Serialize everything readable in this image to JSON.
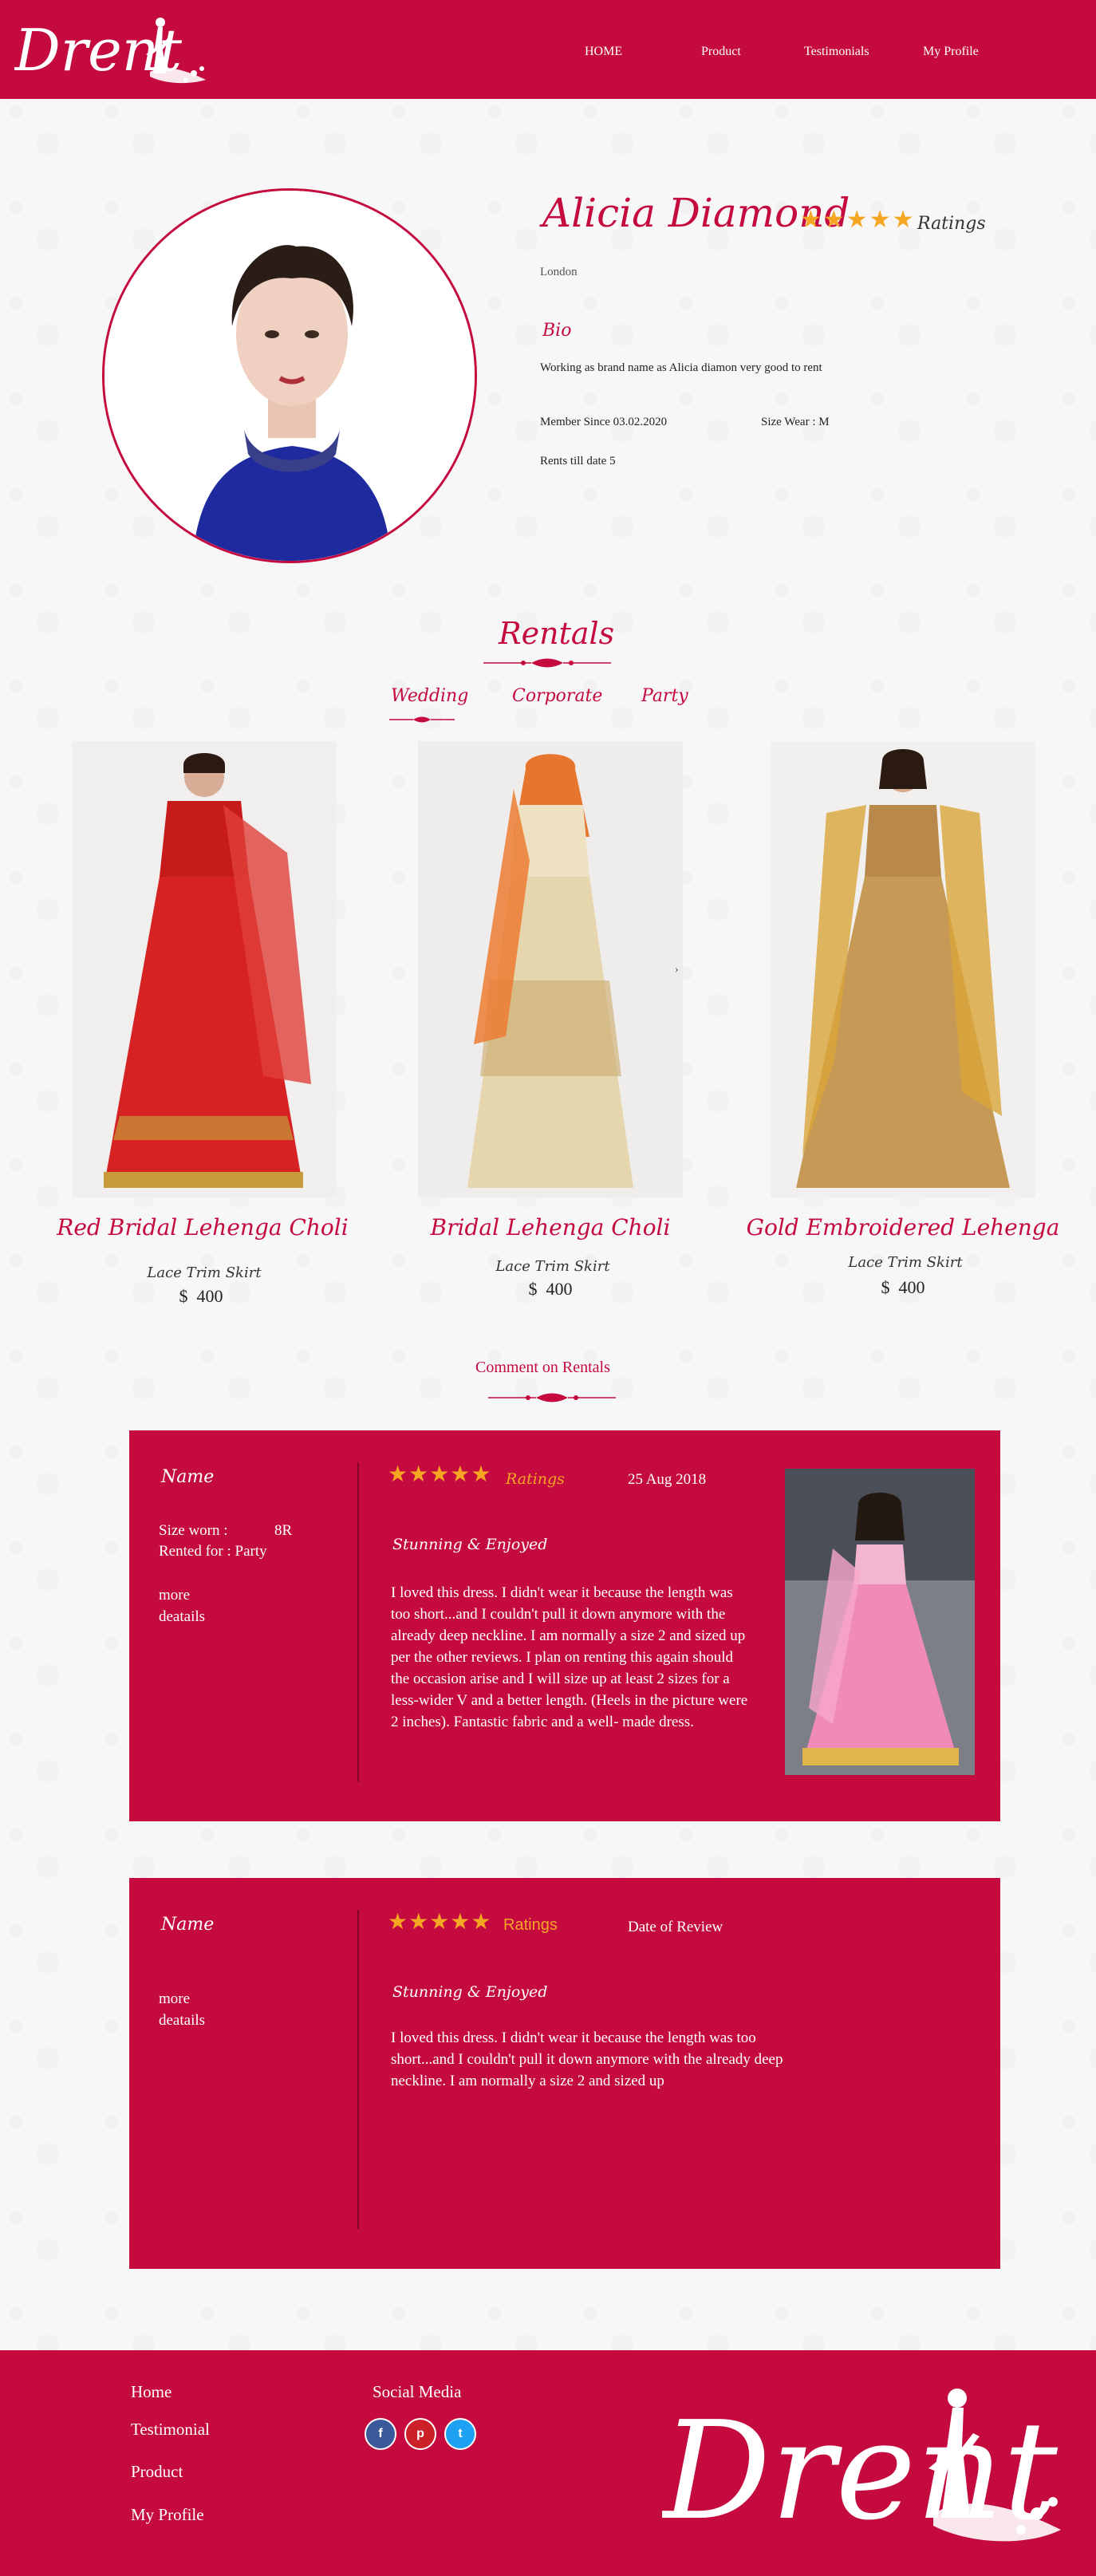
{
  "header": {
    "logo_text": "Drent",
    "nav": [
      "HOME",
      "Product",
      "Testimonials",
      "My Profile"
    ]
  },
  "profile": {
    "name": "Alicia Diamond",
    "stars": "★★★★★",
    "ratings_label": "Ratings",
    "location": "London",
    "bio_title": "Bio",
    "bio": "Working as brand name as Alicia diamon very good to rent",
    "member_since": "Member Since 03.02.2020",
    "size_wear": "Size Wear : M",
    "rents": "Rents till date 5"
  },
  "rentals": {
    "title": "Rentals",
    "tabs": [
      "Wedding",
      "Corporate",
      "Party"
    ],
    "products": [
      {
        "name": "Red Bridal Lehenga Choli",
        "sub": "Lace Trim Skirt",
        "currency": "$",
        "price": "400"
      },
      {
        "name": "Bridal Lehenga Choli",
        "sub": "Lace Trim Skirt",
        "currency": "$",
        "price": "400"
      },
      {
        "name": "Gold Embroidered Lehenga",
        "sub": "Lace Trim Skirt",
        "currency": "$",
        "price": "400"
      }
    ],
    "arrow": "›"
  },
  "comments": {
    "title": "Comment on Rentals",
    "reviews": [
      {
        "name": "Name",
        "size_worn_label": "Size worn :",
        "size_worn_value": "8R",
        "rented_for": "Rented for : Party",
        "more1": "more",
        "more2": "deatails",
        "stars": "★★★★★",
        "ratings": "Ratings",
        "date": "25 Aug 2018",
        "headline": "Stunning & Enjoyed",
        "body": "I loved this dress. I didn't wear it because the length was too short...and I couldn't pull it down anymore with the already deep neckline. I am normally a size 2 and sized up per the other reviews. I plan on renting this again should the occasion arise and I will size up at least 2 sizes for a less-wider V and a better length. (Heels in the picture were 2 inches). Fantastic fabric and a well- made dress."
      },
      {
        "name": "Name",
        "more1": "more",
        "more2": "deatails",
        "stars": "★★★★★",
        "ratings": "Ratings",
        "date": "Date of Review",
        "headline": "Stunning & Enjoyed",
        "body": "I loved this dress. I didn't wear it because the length was too short...and I couldn't pull it down anymore with the already deep neckline. I am normally a size 2 and sized up"
      }
    ]
  },
  "footer": {
    "links": [
      "Home",
      "Testimonial",
      "Product",
      "My Profile"
    ],
    "social_title": "Social Media",
    "social_icons": [
      "f",
      "p",
      "t"
    ],
    "logo_text": "Drent"
  },
  "colors": {
    "brand": "#c40a3e",
    "star": "#f5a623"
  }
}
